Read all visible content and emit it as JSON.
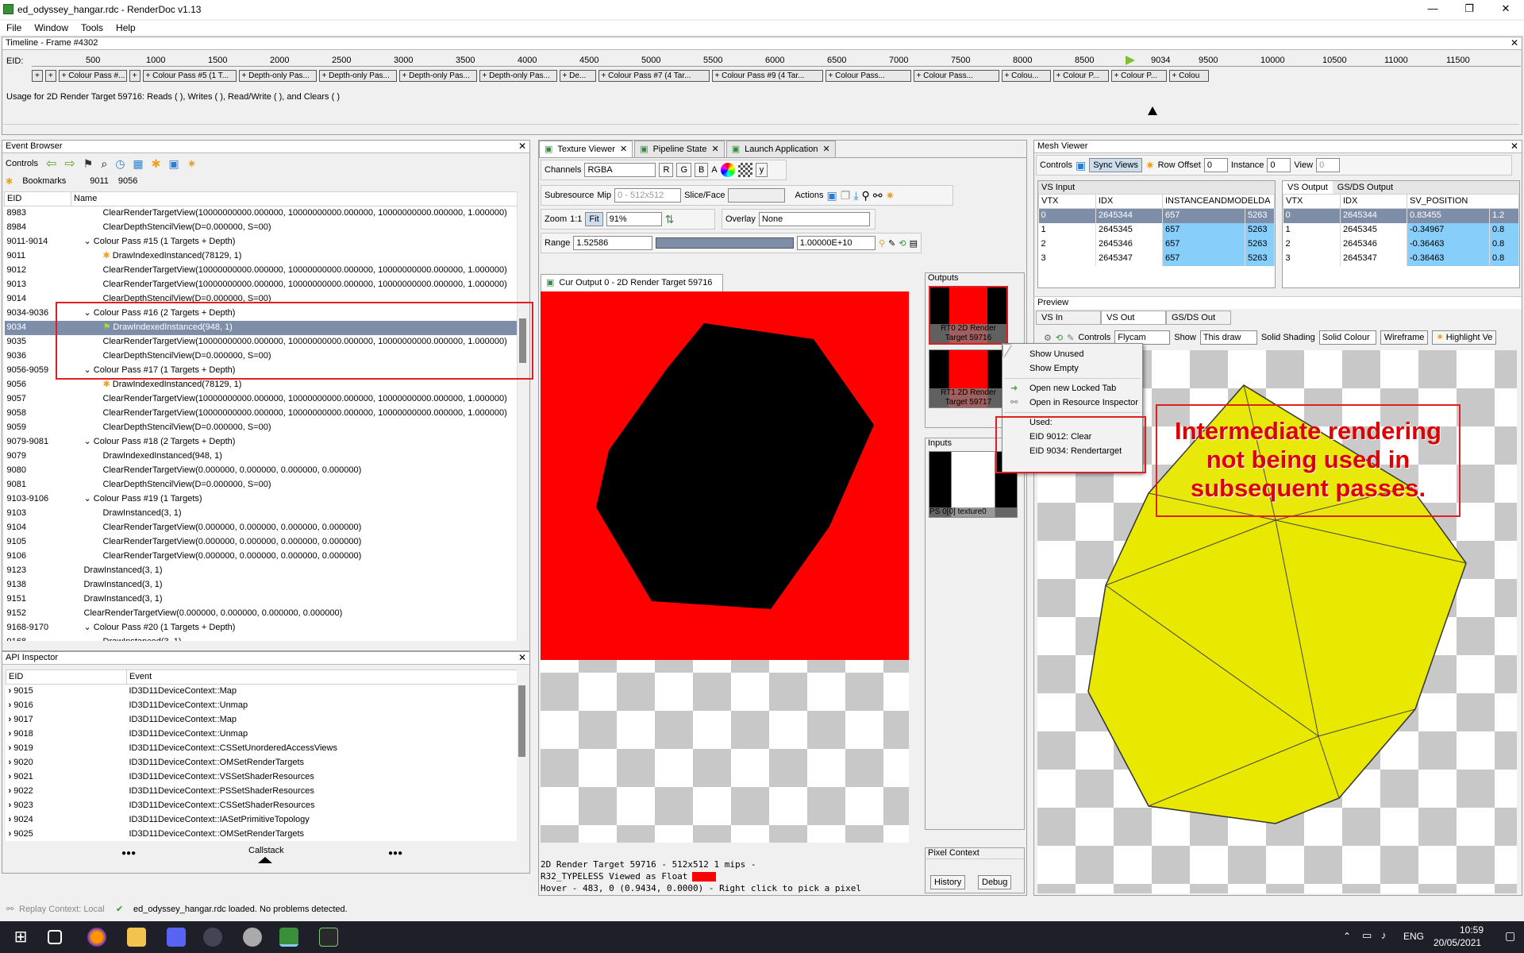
{
  "window": {
    "title": "ed_odyssey_hangar.rdc - RenderDoc v1.13",
    "min": "—",
    "max": "❐",
    "close": "✕"
  },
  "menu": [
    "File",
    "Window",
    "Tools",
    "Help"
  ],
  "timeline": {
    "title": "Timeline - Frame #4302",
    "eid_label": "EID:",
    "ticks": [
      "500",
      "1000",
      "1500",
      "2000",
      "2500",
      "3000",
      "3500",
      "4000",
      "4500",
      "5000",
      "5500",
      "6000",
      "6500",
      "7000",
      "7500",
      "8000",
      "8500",
      "9034",
      "9500",
      "10000",
      "10500",
      "11000",
      "11500"
    ],
    "passes": [
      "+",
      "+",
      "+ Colour Pass #...",
      "+",
      "+ Colour Pass #5 (1 T...",
      "+ Depth-only Pas...",
      "+ Depth-only Pas...",
      "+ Depth-only Pas...",
      "+ Depth-only Pas...",
      "+ De...",
      "+ Colour Pass #7 (4 Tar...",
      "+ Colour Pass #9 (4 Tar...",
      "+ Colour Pass...",
      "+ Colour Pass...",
      "+ Colou...",
      "+ Colour P...",
      "+ Colour P...",
      "+ Colou"
    ],
    "usage": "Usage for 2D Render Target 59716: Reads ( ), Writes ( ), Read/Write ( ), and Clears ( )"
  },
  "event_browser": {
    "title": "Event Browser",
    "controls_label": "Controls",
    "bookmarks_label": "Bookmarks",
    "bookmarks": [
      "9011",
      "9056"
    ],
    "col_eid": "EID",
    "col_name": "Name",
    "rows": [
      {
        "eid": "8983",
        "name": "ClearRenderTargetView(10000000000.000000, 10000000000.000000, 10000000000.000000, 1.000000)",
        "indent": 2
      },
      {
        "eid": "8984",
        "name": "ClearDepthStencilView(D=0.000000, S=00)",
        "indent": 2
      },
      {
        "eid": "9011-9014",
        "name": "Colour Pass #15 (1 Targets + Depth)",
        "indent": 1,
        "exp": "v"
      },
      {
        "eid": "9011",
        "name": "DrawIndexedInstanced(78129, 1)",
        "indent": 2,
        "icon": "bookmark"
      },
      {
        "eid": "9012",
        "name": "ClearRenderTargetView(10000000000.000000, 10000000000.000000, 10000000000.000000, 1.000000)",
        "indent": 2
      },
      {
        "eid": "9013",
        "name": "ClearRenderTargetView(10000000000.000000, 10000000000.000000, 10000000000.000000, 1.000000)",
        "indent": 2
      },
      {
        "eid": "9014",
        "name": "ClearDepthStencilView(D=0.000000, S=00)",
        "indent": 2
      },
      {
        "eid": "9034-9036",
        "name": "Colour Pass #16 (2 Targets + Depth)",
        "indent": 1,
        "exp": "v"
      },
      {
        "eid": "9034",
        "name": "DrawIndexedInstanced(948, 1)",
        "indent": 2,
        "icon": "flag",
        "selected": true
      },
      {
        "eid": "9035",
        "name": "ClearRenderTargetView(10000000000.000000, 10000000000.000000, 10000000000.000000, 1.000000)",
        "indent": 2
      },
      {
        "eid": "9036",
        "name": "ClearDepthStencilView(D=0.000000, S=00)",
        "indent": 2
      },
      {
        "eid": "9056-9059",
        "name": "Colour Pass #17 (1 Targets + Depth)",
        "indent": 1,
        "exp": "v"
      },
      {
        "eid": "9056",
        "name": "DrawIndexedInstanced(78129, 1)",
        "indent": 2,
        "icon": "bookmark"
      },
      {
        "eid": "9057",
        "name": "ClearRenderTargetView(10000000000.000000, 10000000000.000000, 10000000000.000000, 1.000000)",
        "indent": 2
      },
      {
        "eid": "9058",
        "name": "ClearRenderTargetView(10000000000.000000, 10000000000.000000, 10000000000.000000, 1.000000)",
        "indent": 2
      },
      {
        "eid": "9059",
        "name": "ClearDepthStencilView(D=0.000000, S=00)",
        "indent": 2
      },
      {
        "eid": "9079-9081",
        "name": "Colour Pass #18 (2 Targets + Depth)",
        "indent": 1,
        "exp": "v"
      },
      {
        "eid": "9079",
        "name": "DrawIndexedInstanced(948, 1)",
        "indent": 2
      },
      {
        "eid": "9080",
        "name": "ClearRenderTargetView(0.000000, 0.000000, 0.000000, 0.000000)",
        "indent": 2
      },
      {
        "eid": "9081",
        "name": "ClearDepthStencilView(D=0.000000, S=00)",
        "indent": 2
      },
      {
        "eid": "9103-9106",
        "name": "Colour Pass #19 (1 Targets)",
        "indent": 1,
        "exp": "v"
      },
      {
        "eid": "9103",
        "name": "DrawInstanced(3, 1)",
        "indent": 2
      },
      {
        "eid": "9104",
        "name": "ClearRenderTargetView(0.000000, 0.000000, 0.000000, 0.000000)",
        "indent": 2
      },
      {
        "eid": "9105",
        "name": "ClearRenderTargetView(0.000000, 0.000000, 0.000000, 0.000000)",
        "indent": 2
      },
      {
        "eid": "9106",
        "name": "ClearRenderTargetView(0.000000, 0.000000, 0.000000, 0.000000)",
        "indent": 2
      },
      {
        "eid": "9123",
        "name": "DrawInstanced(3, 1)",
        "indent": 1
      },
      {
        "eid": "9138",
        "name": "DrawInstanced(3, 1)",
        "indent": 1
      },
      {
        "eid": "9151",
        "name": "DrawInstanced(3, 1)",
        "indent": 1
      },
      {
        "eid": "9152",
        "name": "ClearRenderTargetView(0.000000, 0.000000, 0.000000, 0.000000)",
        "indent": 1
      },
      {
        "eid": "9168-9170",
        "name": "Colour Pass #20 (1 Targets + Depth)",
        "indent": 1,
        "exp": "v"
      },
      {
        "eid": "9168",
        "name": "DrawInstanced(3, 1)",
        "indent": 2
      }
    ]
  },
  "api_inspector": {
    "title": "API Inspector",
    "col_eid": "EID",
    "col_event": "Event",
    "rows": [
      {
        "eid": "9015",
        "event": "ID3D11DeviceContext::Map"
      },
      {
        "eid": "9016",
        "event": "ID3D11DeviceContext::Unmap"
      },
      {
        "eid": "9017",
        "event": "ID3D11DeviceContext::Map"
      },
      {
        "eid": "9018",
        "event": "ID3D11DeviceContext::Unmap"
      },
      {
        "eid": "9019",
        "event": "ID3D11DeviceContext::CSSetUnorderedAccessViews"
      },
      {
        "eid": "9020",
        "event": "ID3D11DeviceContext::OMSetRenderTargets"
      },
      {
        "eid": "9021",
        "event": "ID3D11DeviceContext::VSSetShaderResources"
      },
      {
        "eid": "9022",
        "event": "ID3D11DeviceContext::PSSetShaderResources"
      },
      {
        "eid": "9023",
        "event": "ID3D11DeviceContext::CSSetShaderResources"
      },
      {
        "eid": "9024",
        "event": "ID3D11DeviceContext::IASetPrimitiveTopology"
      },
      {
        "eid": "9025",
        "event": "ID3D11DeviceContext::OMSetRenderTargets"
      }
    ],
    "dots_left": "●●●",
    "callstack": "Callstack",
    "dots_right": "●●●"
  },
  "texture_viewer": {
    "tabs": [
      "Texture Viewer",
      "Pipeline State",
      "Launch Application"
    ],
    "channels_label": "Channels",
    "channels_value": "RGBA",
    "r": "R",
    "g": "G",
    "b": "B",
    "a": "A",
    "subresource_label": "Subresource",
    "mip_label": "Mip",
    "mip_value": "0 - 512x512",
    "slice_label": "Slice/Face",
    "actions_label": "Actions",
    "zoom_label": "Zoom",
    "zoom_11": "1:1",
    "fit_label": "Fit",
    "zoom_value": "91%",
    "overlay_label": "Overlay",
    "overlay_value": "None",
    "range_label": "Range",
    "range_min": "1.52586",
    "range_max": "1.00000E+10",
    "cur_output_tab": "Cur Output 0 - 2D Render Target 59716",
    "outputs_label": "Outputs",
    "rt0": "RT0 2D Render Target 59716",
    "rt1": "RT1 2D Render Target 59717",
    "inputs_label": "Inputs",
    "input0": "PS 0[0]   texture0",
    "info_line1": "2D Render Target 59716 - 512x512 1 mips -",
    "info_line2": "R32_TYPELESS Viewed as Float",
    "info_line3": "Hover -    483,    0 (0.9434, 0.0000)  - Right click to pick a pixel",
    "pixel_context": "Pixel Context",
    "history": "History",
    "debug": "Debug"
  },
  "context_menu": {
    "items": [
      "Show Unused",
      "Show Empty",
      "Open new Locked Tab",
      "Open in Resource Inspector"
    ],
    "used_label": "Used:",
    "used": [
      "EID 9012: Clear",
      "EID 9034: Rendertarget"
    ]
  },
  "mesh_viewer": {
    "title": "Mesh Viewer",
    "controls_label": "Controls",
    "sync_views": "Sync Views",
    "row_offset_label": "Row Offset",
    "row_offset": "0",
    "instance_label": "Instance",
    "instance": "0",
    "view_label": "View",
    "view": "0",
    "vs_input_tab": "VS Input",
    "vs_input_cols": [
      "VTX",
      "IDX",
      "INSTANCEANDMODELDA"
    ],
    "vs_input_rows": [
      [
        "0",
        "2645344",
        "657",
        "5263"
      ],
      [
        "1",
        "2645345",
        "657",
        "5263"
      ],
      [
        "2",
        "2645346",
        "657",
        "5263"
      ],
      [
        "3",
        "2645347",
        "657",
        "5263"
      ]
    ],
    "vs_output_tab": "VS Output",
    "gsds_output_tab": "GS/DS Output",
    "vs_output_cols": [
      "VTX",
      "IDX",
      "SV_POSITION"
    ],
    "vs_output_rows": [
      [
        "0",
        "2645344",
        "0.83455",
        "1.2"
      ],
      [
        "1",
        "2645345",
        "-0.34967",
        "0.8"
      ],
      [
        "2",
        "2645346",
        "-0.36463",
        "0.8"
      ],
      [
        "3",
        "2645347",
        "-0.36463",
        "0.8"
      ]
    ],
    "preview_label": "Preview",
    "preview_tabs": [
      "VS In",
      "VS Out",
      "GS/DS Out"
    ],
    "flycam_label": "Controls",
    "flycam_value": "Flycam",
    "show_label": "Show",
    "show_value": "This draw",
    "solid_label": "Solid Shading",
    "solid_value": "Solid Colour",
    "wireframe": "Wireframe",
    "highlight": "Highlight Ve"
  },
  "callout": "Intermediate rendering not being used in subsequent passes.",
  "status": {
    "replay": "Replay Context: Local",
    "message": "ed_odyssey_hangar.rdc loaded. No problems detected."
  },
  "taskbar": {
    "lang": "ENG",
    "time": "10:59",
    "date": "20/05/2021"
  }
}
